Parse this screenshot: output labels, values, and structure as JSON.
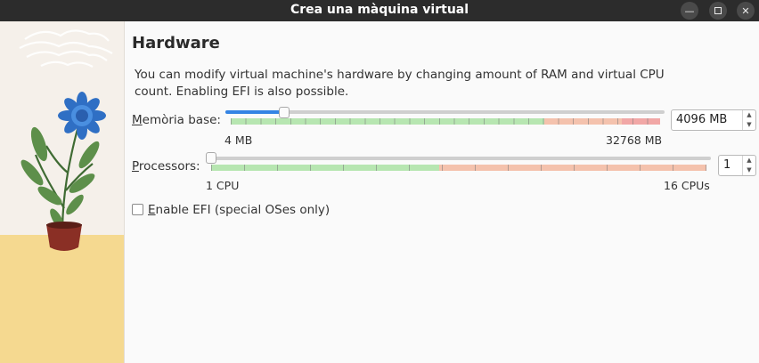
{
  "window": {
    "title": "Crea una màquina virtual",
    "minimize_icon": "minimize-icon",
    "maximize_icon": "maximize-icon",
    "close_icon": "close-icon"
  },
  "page": {
    "heading": "Hardware",
    "description": "You can modify virtual machine's hardware by changing amount of RAM and virtual CPU count. Enabling EFI is also possible."
  },
  "memory": {
    "label": "Memòria base:",
    "mnemonic": "M",
    "label_rest": "emòria base:",
    "value": "4096 MB",
    "min_label": "4 MB",
    "max_label": "32768 MB",
    "value_mb": 4096,
    "min_mb": 4,
    "max_mb": 32768,
    "zones": {
      "green_fraction": 0.73,
      "orange_fraction": 0.18,
      "red_fraction": 0.09
    }
  },
  "processors": {
    "label": "Processors:",
    "mnemonic": "P",
    "label_rest": "rocessors:",
    "value": "1",
    "min_label": "1 CPU",
    "max_label": "16 CPUs",
    "value_cpu": 1,
    "min_cpu": 1,
    "max_cpu": 16,
    "zones": {
      "green_fraction": 0.46,
      "orange_fraction": 0.54
    }
  },
  "efi": {
    "label": "Enable EFI (special OSes only)",
    "mnemonic": "E",
    "label_rest": "nable EFI (special OSes only)",
    "checked": false
  },
  "colors": {
    "accent": "#3584e4",
    "zone_green": "#b7e6b1",
    "zone_orange": "#f4c2ad",
    "zone_red": "#f1a7a6",
    "titlebar": "#2c2c2c"
  }
}
